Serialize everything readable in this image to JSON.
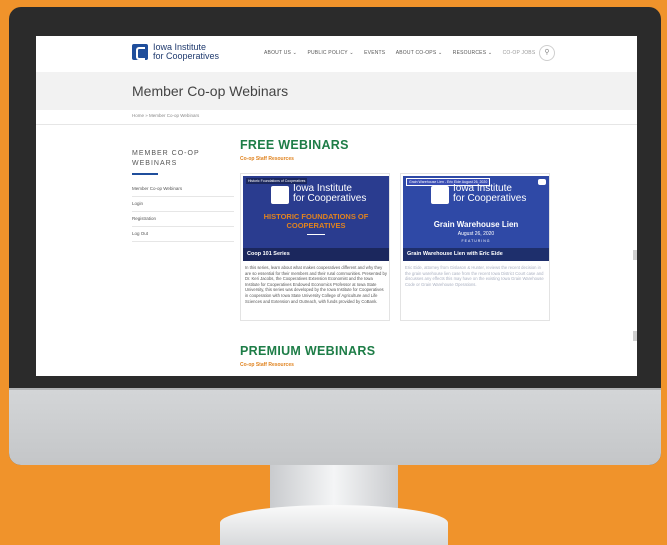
{
  "site": {
    "logo_line1": "Iowa Institute",
    "logo_line2": "for Cooperatives"
  },
  "nav": {
    "items": [
      "ABOUT US ⌄",
      "PUBLIC POLICY ⌄",
      "EVENTS",
      "ABOUT CO-OPS ⌄",
      "RESOURCES ⌄",
      "CO-OP JOBS"
    ],
    "search_icon": "search-icon"
  },
  "page": {
    "title": "Member Co-op Webinars",
    "breadcrumb": "Home » Member Co-op Webinars"
  },
  "sidebar": {
    "heading_line1": "MEMBER CO-OP",
    "heading_line2": "WEBINARS",
    "items": [
      {
        "label": "Member Co-op Webinars"
      },
      {
        "label": "Login"
      },
      {
        "label": "Registration"
      },
      {
        "label": "Log Out"
      }
    ]
  },
  "free": {
    "title": "FREE WEBINARS",
    "subtitle": "Co-op Staff Resources"
  },
  "premium": {
    "title": "PREMIUM WEBINARS",
    "subtitle": "Co-op Staff Resources"
  },
  "cards": [
    {
      "video_label": "Historic Foundations of Cooperatives",
      "logo_line1": "Iowa Institute",
      "logo_line2": "for Cooperatives",
      "heading_line1": "HISTORIC FOUNDATIONS OF",
      "heading_line2": "COOPERATIVES",
      "caption": "Coop 101 Series",
      "text": "In this series, learn about what makes cooperatives different and why they are so essential for their members and their rural communities. Presented by Dr. Keri Jacobs, the Cooperatives Extension Economist and the Iowa Institute for Cooperatives Endowed Economics Professor at Iowa State University, this series was developed by the Iowa Institute for Cooperatives in cooperation with Iowa State University College of Agriculture and Life Sciences and Extension and Outreach, with funds provided by CoBank."
    },
    {
      "video_label": "Grain Warehouse Lien - Eric Eide August 26, 2020",
      "logo_line1": "Iowa Institute",
      "logo_line2": "for Cooperatives",
      "heading": "Grain Warehouse Lien",
      "date": "August 26, 2020",
      "featuring": "FEATURING",
      "caption": "Grain Warehouse Lien with Eric Eide",
      "text": "Eric Eide, attorney from Gislason & Hunter, reviews the recent decision in the grain warehouse lien case from the recent Iowa District Court case and discusses any effects this may have on the existing Iowa Grain Warehouse Code or Grain Warehouse Operations."
    }
  ]
}
